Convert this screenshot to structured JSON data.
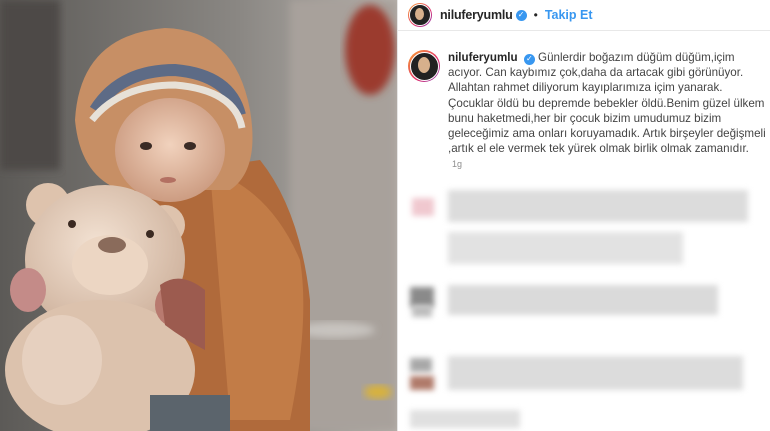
{
  "post": {
    "username": "niluferyumlu",
    "separator": "•",
    "follow_label": "Takip Et",
    "verified_icon": "✓"
  },
  "caption": {
    "username": "niluferyumlu",
    "text": "Günlerdir boğazım düğüm düğüm,içim acıyor. Can kaybımız çok,daha da artacak gibi görünüyor. Allahtan rahmet diliyorum kayıplarımıza içim yanarak. Çocuklar öldü bu depremde bebekler öldü.Benim güzel ülkem bunu haketmedi,her bir çocuk bizim umudumuz bizim geleceğimiz ama onları koruyamadık. Artık birşeyler değişmeli ,artık el ele vermek tek yürek olmak birlik olmak zamanıdır.",
    "time": "1g"
  },
  "colors": {
    "accent": "#3897f0",
    "text": "#262626"
  }
}
